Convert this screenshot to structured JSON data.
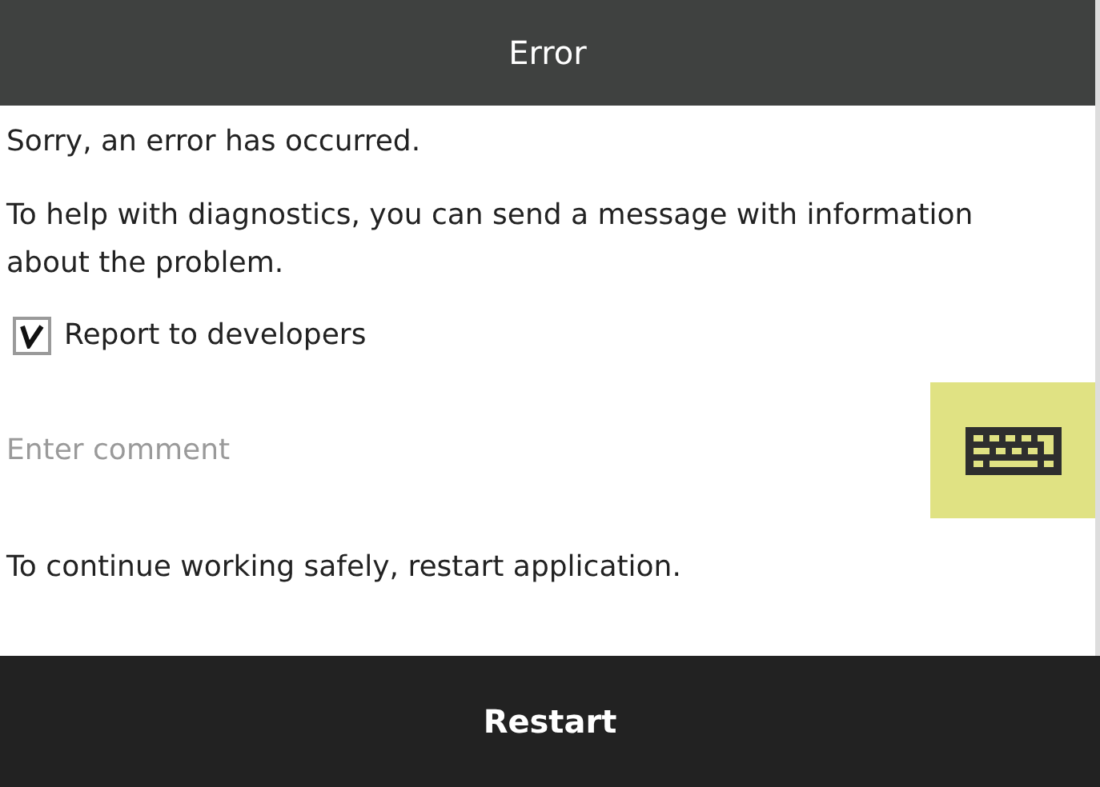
{
  "window": {
    "title": "Error"
  },
  "messages": [
    "Sorry, an error has occurred.",
    "To help with diagnostics, you can send a message with information about the problem."
  ],
  "report": {
    "label": "Report to developers",
    "checked": true
  },
  "comment": {
    "placeholder": "Enter comment"
  },
  "footer_note": "To continue working safely, restart application.",
  "buttons": [
    "Restart"
  ]
}
